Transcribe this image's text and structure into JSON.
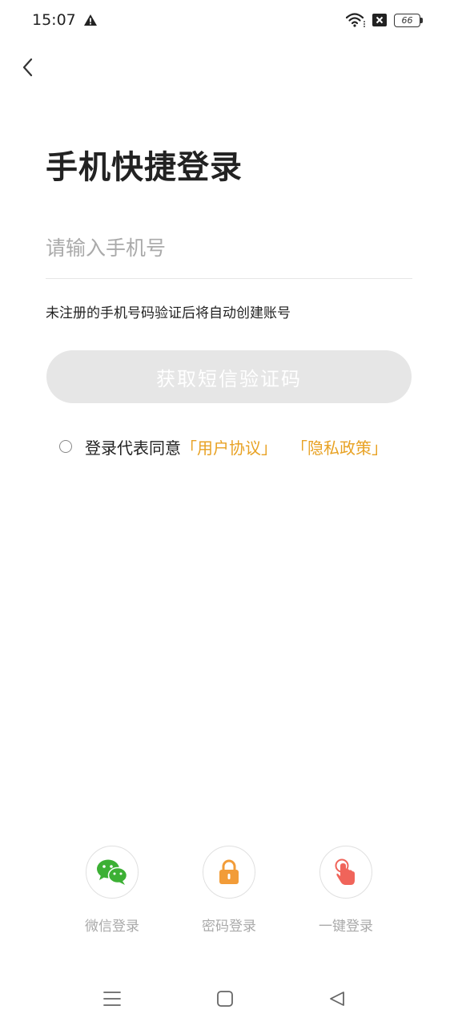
{
  "status_bar": {
    "time": "15:07",
    "battery": "66"
  },
  "header": {
    "title": "手机快捷登录"
  },
  "form": {
    "phone_placeholder": "请输入手机号",
    "phone_value": "",
    "hint": "未注册的手机号码验证后将自动创建账号",
    "sms_button_label": "获取短信验证码"
  },
  "agreement": {
    "prefix": "登录代表同意",
    "user_agreement": "「用户协议」",
    "privacy_policy": "「隐私政策」",
    "checked": false
  },
  "alt_login": {
    "items": [
      {
        "label": "微信登录",
        "icon": "wechat-icon"
      },
      {
        "label": "密码登录",
        "icon": "lock-icon"
      },
      {
        "label": "一键登录",
        "icon": "tap-icon"
      }
    ]
  },
  "colors": {
    "accent": "#e8a224",
    "button_disabled": "#e6e6e6",
    "wechat": "#3cb034",
    "lock": "#f29c38",
    "tap": "#f0645a"
  }
}
